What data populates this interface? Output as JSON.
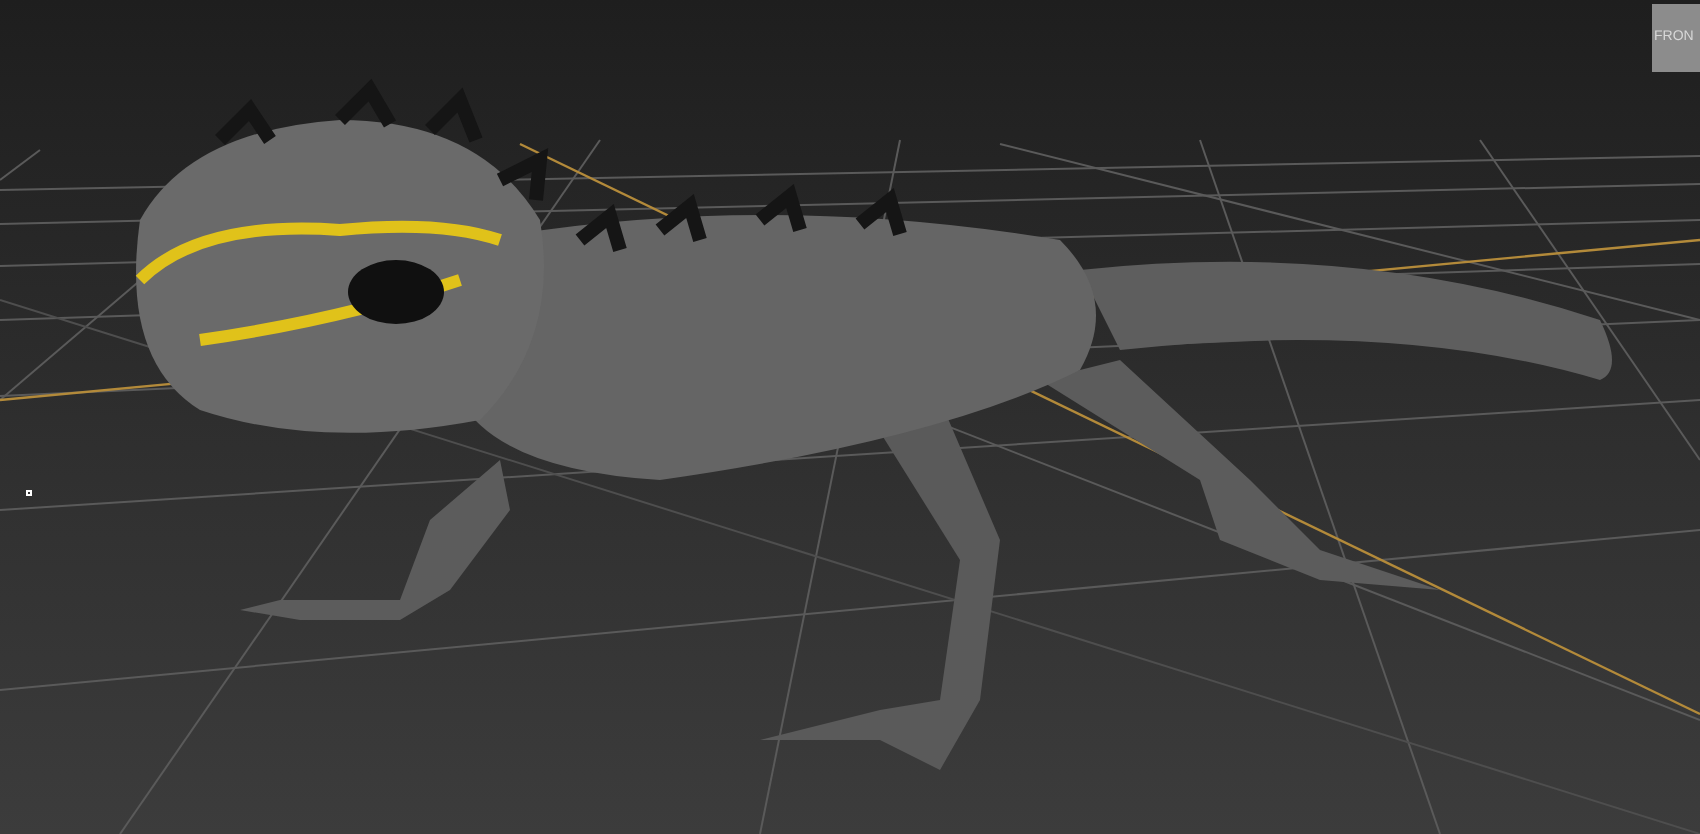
{
  "viewport": {
    "view_cube": {
      "face_label": "FRON"
    }
  }
}
